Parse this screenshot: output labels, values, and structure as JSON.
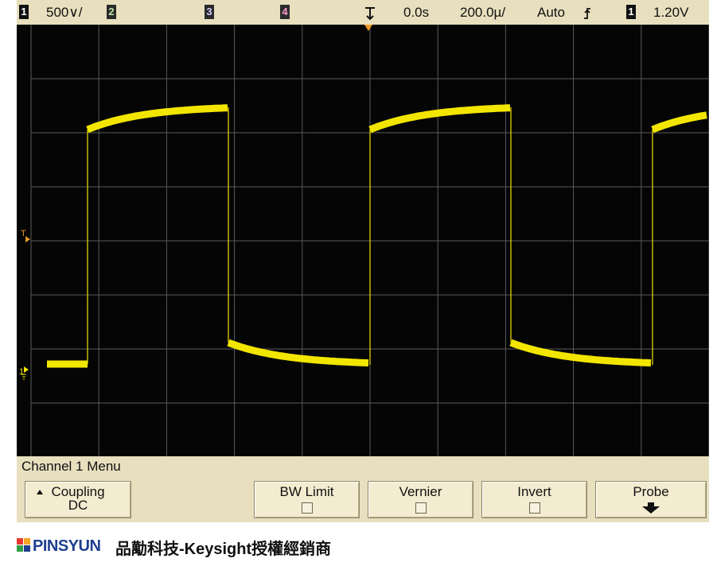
{
  "topbar": {
    "ch1_label": "1",
    "ch1_scale": "500∨/",
    "ch2_label": "2",
    "ch3_label": "3",
    "ch4_label": "4",
    "time_delay": "0.0s",
    "time_scale": "200.0µ/",
    "trigger_mode": "Auto",
    "trigger_slope_icon": "rising-edge-icon",
    "trigger_source": "1",
    "trigger_level": "1.20V"
  },
  "screen": {
    "trace_color": "#f2e600",
    "grid_color": "#5a5a5a",
    "trigger_marker": "T",
    "ground_marker": "1"
  },
  "menu": {
    "title": "Channel 1  Menu",
    "softkeys": [
      {
        "label": "Coupling",
        "value": "DC"
      },
      {
        "label": "BW Limit"
      },
      {
        "label": "Vernier"
      },
      {
        "label": "Invert"
      },
      {
        "label": "Probe"
      }
    ]
  },
  "footer": {
    "logo_text": "PINSYUN",
    "text": "品勱科技-Keysight授權經銷商"
  }
}
